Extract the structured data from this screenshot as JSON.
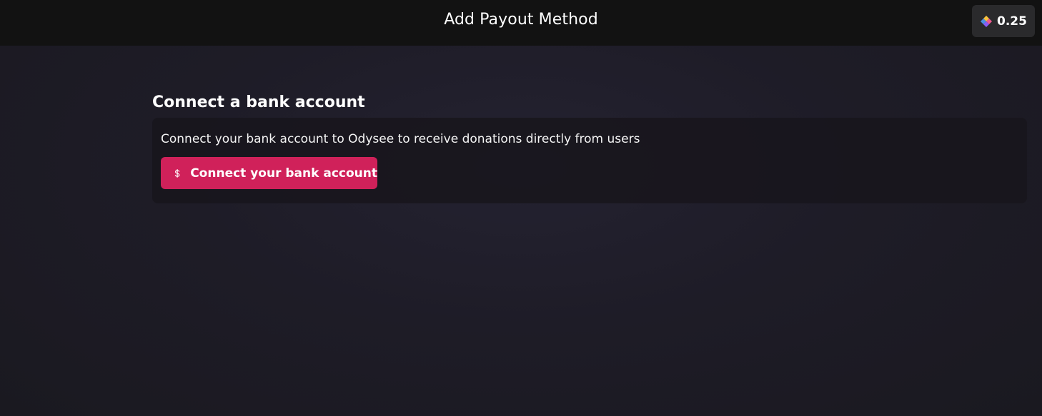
{
  "header": {
    "title": "Add Payout Method",
    "balance": {
      "value": "0.25",
      "icon": "credits-icon"
    }
  },
  "main": {
    "section_title": "Connect a bank account",
    "card": {
      "description": "Connect your bank account to Odysee to receive donations directly from users",
      "button": {
        "label": "Connect your bank account",
        "icon": "dollar-icon"
      }
    }
  },
  "colors": {
    "header_bg": "#121212",
    "page_bg": "#1d1b24",
    "card_bg": "#18161c",
    "accent": "#d0215a",
    "balance_bg": "#2a2a2c"
  }
}
